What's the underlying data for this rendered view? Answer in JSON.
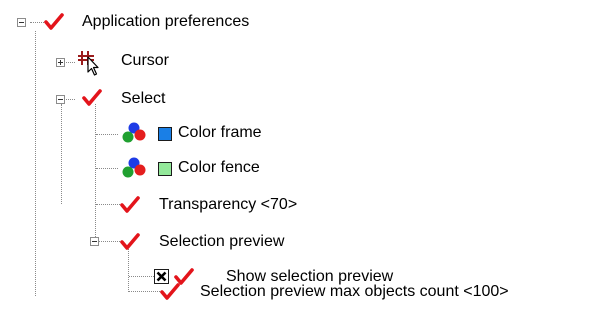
{
  "tree": {
    "root": {
      "label": "Application preferences",
      "expanded": true,
      "checked": true
    },
    "cursor": {
      "label": "Cursor",
      "expanded": false
    },
    "select": {
      "label": "Select",
      "expanded": true,
      "checked": true
    },
    "color_frame": {
      "label": "Color frame",
      "color": "#1a7fe6",
      "icon": "rgb-dots-icon"
    },
    "color_fence": {
      "label": "Color fence",
      "color": "#93e89a",
      "icon": "rgb-dots-icon"
    },
    "transparency": {
      "label": "Transparency <70>",
      "checked": true
    },
    "selection_preview": {
      "label": "Selection preview",
      "expanded": true,
      "checked": true
    },
    "show_selection_preview": {
      "label": "Show selection preview",
      "checkbox_checked": true,
      "checked": true
    },
    "max_objects": {
      "label": "Selection preview max objects count <100>",
      "checked": true
    }
  },
  "colors": {
    "check": "#e3141b",
    "cursor_icon": "#9b1c1c",
    "dot_red": "#e41e1e",
    "dot_green": "#20a030",
    "dot_blue": "#1e3ce6"
  }
}
